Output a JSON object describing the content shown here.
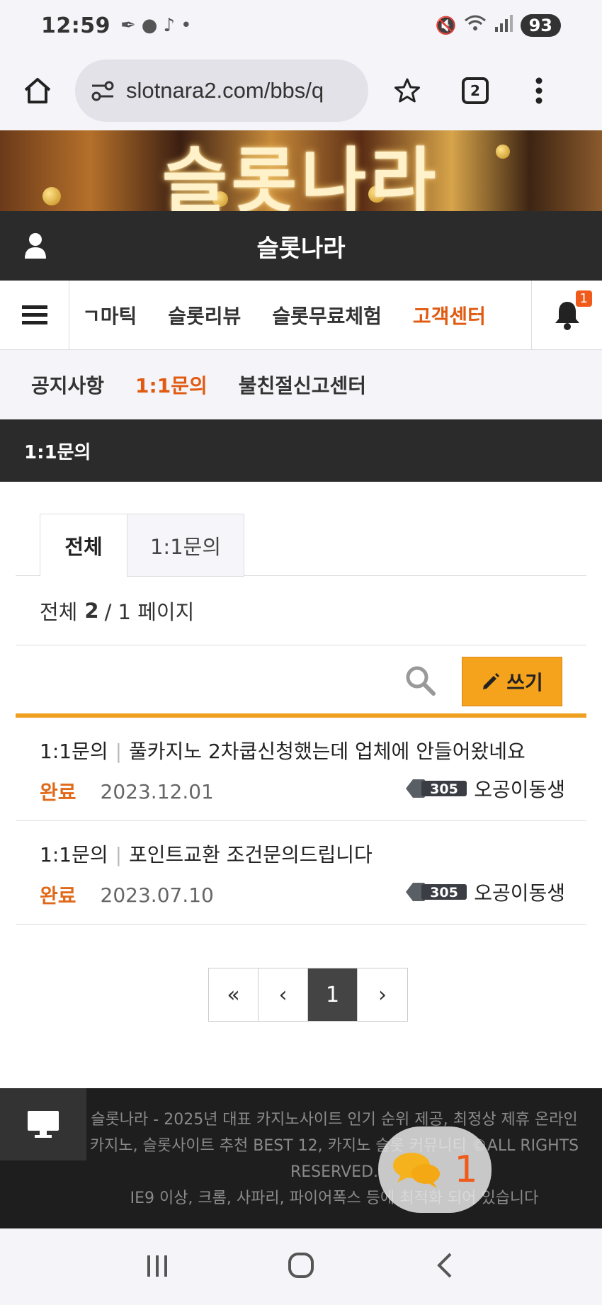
{
  "status_bar": {
    "time": "12:59",
    "battery": "93"
  },
  "browser": {
    "url": "slotnara2.com/bbs/q",
    "tab_count": "2"
  },
  "banner": {
    "text": "슬롯나라"
  },
  "site": {
    "title": "슬롯나라"
  },
  "nav": {
    "items": [
      {
        "label": "ㄱ마틱"
      },
      {
        "label": "슬롯리뷰"
      },
      {
        "label": "슬롯무료체험"
      },
      {
        "label": "고객센터"
      }
    ],
    "notification_count": "1"
  },
  "subnav": {
    "items": [
      {
        "label": "공지사항"
      },
      {
        "label": "1:1문의"
      },
      {
        "label": "불친절신고센터"
      }
    ]
  },
  "board": {
    "title": "1:1문의",
    "tabs": [
      {
        "label": "전체"
      },
      {
        "label": "1:1문의"
      }
    ],
    "count_prefix": "전체",
    "total": "2",
    "count_suffix": "/ 1 페이지",
    "write_label": "쓰기",
    "posts": [
      {
        "category": "1:1문의",
        "separator": "|",
        "title": "풀카지노 2차쿱신청했는데 업체에 안들어왔네요",
        "status": "완료",
        "date": "2023.12.01",
        "level": "305",
        "author": "오공이동생"
      },
      {
        "category": "1:1문의",
        "separator": "|",
        "title": "포인트교환 조건문의드립니다",
        "status": "완료",
        "date": "2023.07.10",
        "level": "305",
        "author": "오공이동생"
      }
    ],
    "pager": {
      "first": "«",
      "prev": "‹",
      "current": "1",
      "next": "›"
    }
  },
  "footer": {
    "text": "슬롯나라 - 2025년 대표 카지노사이트 인기 순위 제공, 최정상 제휴 온라인 카지노, 슬롯사이트 추천 BEST 12, 카지노 슬롯 커뮤니티 ©ALL RIGHTS RESERVED.",
    "compat": "IE9 이상, 크롬, 사파리, 파이어폭스 등에 최적화 되어 있습니다"
  },
  "chat": {
    "count": "1"
  },
  "colors": {
    "accent": "#e05a10",
    "write_button": "#f5a21c",
    "header_bg": "#2b2b2b"
  }
}
